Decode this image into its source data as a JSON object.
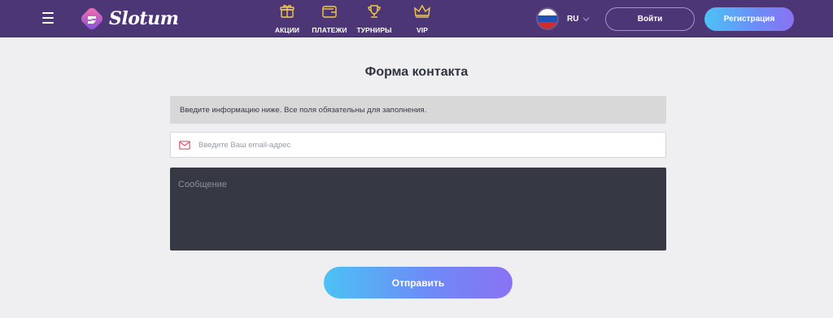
{
  "header": {
    "logo_text": "Slotum",
    "nav": [
      {
        "label": "АКЦИИ",
        "icon": "gift-icon"
      },
      {
        "label": "ПЛАТЕЖИ",
        "icon": "wallet-icon"
      },
      {
        "label": "ТУРНИРЫ",
        "icon": "trophy-icon"
      },
      {
        "label": "VIP",
        "icon": "crown-icon"
      }
    ],
    "language": {
      "code": "RU",
      "flag": "russia-flag"
    },
    "login_label": "Войти",
    "register_label": "Регистрация"
  },
  "form": {
    "title": "Форма контакта",
    "info_text": "Введите информацию ниже. Все поля обязательны для заполнения.",
    "email_placeholder": "Введите Ваш email-адрес",
    "message_placeholder": "Сообщение",
    "submit_label": "Отправить"
  },
  "colors": {
    "header_bg": "#4d3676",
    "nav_icon": "#f2c94c",
    "accent_gradient_start": "#4cc2f5",
    "accent_gradient_end": "#8a72f4",
    "message_bg": "#363944",
    "email_icon": "#e0556b"
  }
}
